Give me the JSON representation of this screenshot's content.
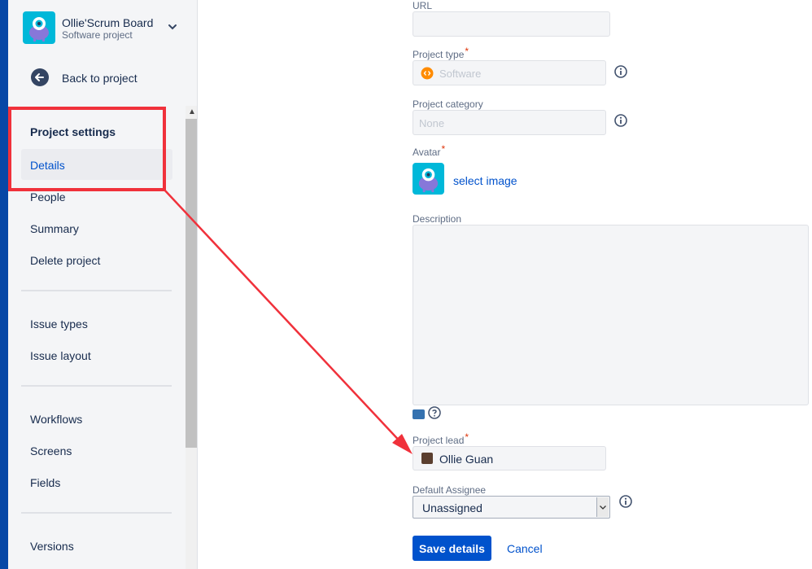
{
  "sidebar": {
    "project": {
      "name": "Ollie'Scrum Board",
      "type": "Software project"
    },
    "back_label": "Back to project",
    "section_title": "Project settings",
    "items": [
      {
        "label": "Details",
        "selected": true
      },
      {
        "label": "People"
      },
      {
        "label": "Summary"
      },
      {
        "label": "Delete project"
      },
      {
        "label": "Issue types"
      },
      {
        "label": "Issue layout"
      },
      {
        "label": "Workflows"
      },
      {
        "label": "Screens"
      },
      {
        "label": "Fields"
      },
      {
        "label": "Versions"
      }
    ]
  },
  "form": {
    "url": {
      "label": "URL",
      "value": ""
    },
    "project_type": {
      "label": "Project type",
      "value": "Software"
    },
    "project_category": {
      "label": "Project category",
      "value": "None"
    },
    "avatar": {
      "label": "Avatar",
      "select_label": "select image"
    },
    "description": {
      "label": "Description",
      "value": ""
    },
    "project_lead": {
      "label": "Project lead",
      "value": "Ollie Guan"
    },
    "default_assignee": {
      "label": "Default Assignee",
      "value": "Unassigned"
    },
    "required_marker": "*",
    "save_label": "Save details",
    "cancel_label": "Cancel"
  },
  "colors": {
    "accent": "#0052cc",
    "annotation": "#f0313b",
    "sidebar_bg": "#f4f5f7",
    "left_bar": "#0747a6"
  }
}
